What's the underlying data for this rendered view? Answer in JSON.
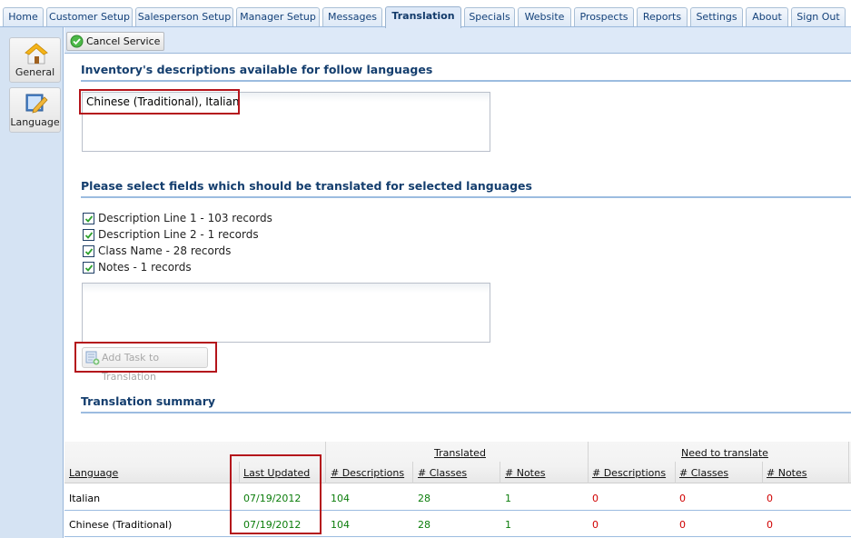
{
  "tabs": [
    {
      "label": "Home",
      "active": false
    },
    {
      "label": "Customer Setup",
      "active": false
    },
    {
      "label": "Salesperson Setup",
      "active": false
    },
    {
      "label": "Manager Setup",
      "active": false
    },
    {
      "label": "Messages",
      "active": false
    },
    {
      "label": "Translation",
      "active": true
    },
    {
      "label": "Specials",
      "active": false
    },
    {
      "label": "Website",
      "active": false
    },
    {
      "label": "Prospects",
      "active": false
    },
    {
      "label": "Reports",
      "active": false
    },
    {
      "label": "Settings",
      "active": false
    },
    {
      "label": "About",
      "active": false
    },
    {
      "label": "Sign Out",
      "active": false
    }
  ],
  "sidebar": {
    "items": [
      {
        "label": "General",
        "icon": "house-icon"
      },
      {
        "label": "Language",
        "icon": "edit-document-icon"
      }
    ]
  },
  "toolbar": {
    "cancel_label": "Cancel Service",
    "cancel_icon": "check-circle-icon"
  },
  "languages_section": {
    "title": "Inventory's descriptions available for follow languages",
    "value": "Chinese (Traditional), Italian"
  },
  "fields_section": {
    "title": "Please select fields which should be translated for selected languages",
    "fields": [
      {
        "label": "Description Line 1 - 103 records",
        "checked": true
      },
      {
        "label": "Description Line 2 - 1 records",
        "checked": true
      },
      {
        "label": "Class Name - 28 records",
        "checked": true
      },
      {
        "label": "Notes - 1 records",
        "checked": true
      }
    ],
    "notes_value": "",
    "add_task_label": "Add Task to Translation"
  },
  "summary": {
    "title": "Translation summary",
    "group_translated": "Translated",
    "group_need": "Need to translate",
    "columns": [
      "Language",
      "Last Updated",
      "# Descriptions",
      "# Classes",
      "# Notes",
      "# Descriptions",
      "# Classes",
      "# Notes"
    ],
    "rows": [
      {
        "language": "Italian",
        "last_updated": "07/19/2012",
        "t_desc": "104",
        "t_classes": "28",
        "t_notes": "1",
        "n_desc": "0",
        "n_classes": "0",
        "n_notes": "0"
      },
      {
        "language": "Chinese (Traditional)",
        "last_updated": "07/19/2012",
        "t_desc": "104",
        "t_classes": "28",
        "t_notes": "1",
        "n_desc": "0",
        "n_classes": "0",
        "n_notes": "0"
      }
    ]
  },
  "colors": {
    "section_title": "#143e6e",
    "translated_value": "#0b7d0b",
    "need_value": "#d00000",
    "highlight": "#b4141b"
  }
}
